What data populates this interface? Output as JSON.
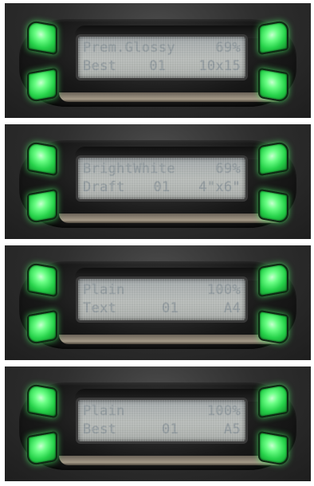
{
  "panels": [
    {
      "line1_left": "Prem.Glossy",
      "line1_right": "69%",
      "line2_left": "Best",
      "line2_mid": "01",
      "line2_right": "10x15"
    },
    {
      "line1_left": "BrightWhite",
      "line1_right": "69%",
      "line2_left": "Draft",
      "line2_mid": "01",
      "line2_right": "4\"x6\""
    },
    {
      "line1_left": "Plain",
      "line1_right": "100%",
      "line2_left": "Text",
      "line2_mid": "01",
      "line2_right": "A4"
    },
    {
      "line1_left": "Plain",
      "line1_right": "100%",
      "line2_left": "Best",
      "line2_mid": "01",
      "line2_right": "A5"
    }
  ],
  "colors": {
    "button_glow": "#26d24a",
    "lcd_background": "#b3b7b4",
    "lcd_text": "#8d969a"
  }
}
